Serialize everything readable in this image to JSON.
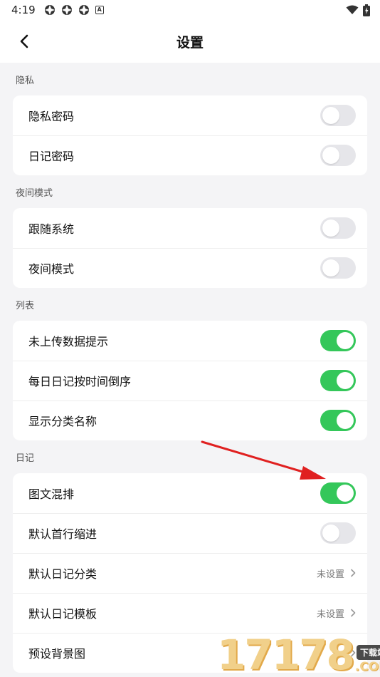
{
  "status_bar": {
    "time": "4:19",
    "icons": [
      "app-notification-icon",
      "app-notification-icon",
      "app-notification-icon",
      "a-icon",
      "wifi-icon",
      "battery-icon"
    ],
    "a_glyph": "A"
  },
  "header": {
    "title": "设置",
    "back_icon": "chevron-left-icon"
  },
  "sections": {
    "privacy": {
      "title": "隐私",
      "items": [
        {
          "label": "隐私密码",
          "toggle": false
        },
        {
          "label": "日记密码",
          "toggle": false
        }
      ]
    },
    "night": {
      "title": "夜间模式",
      "items": [
        {
          "label": "跟随系统",
          "toggle": false
        },
        {
          "label": "夜间模式",
          "toggle": false
        }
      ]
    },
    "list": {
      "title": "列表",
      "items": [
        {
          "label": "未上传数据提示",
          "toggle": true
        },
        {
          "label": "每日日记按时间倒序",
          "toggle": true
        },
        {
          "label": "显示分类名称",
          "toggle": true
        }
      ]
    },
    "diary": {
      "title": "日记",
      "items": [
        {
          "label": "图文混排",
          "toggle": true
        },
        {
          "label": "默认首行缩进",
          "toggle": false
        },
        {
          "label": "默认日记分类",
          "value": "未设置"
        },
        {
          "label": "默认日记模板",
          "value": "未设置"
        },
        {
          "label": "预设背景图"
        }
      ]
    }
  },
  "watermark": {
    "number": "17178",
    "tag": "下载站",
    "domain": ".COM"
  },
  "colors": {
    "toggle_on": "#34c75a",
    "toggle_off": "#e6e6ea",
    "annotation_arrow": "#e02020"
  }
}
